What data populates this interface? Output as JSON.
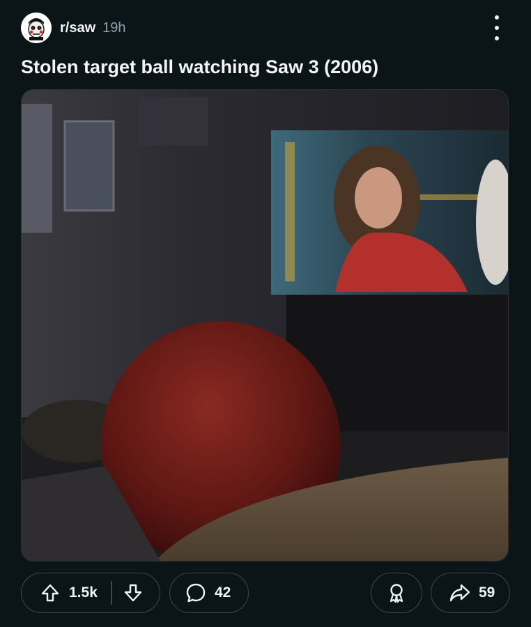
{
  "post": {
    "subreddit": "r/saw",
    "age": "19h",
    "title": "Stolen target ball watching Saw 3 (2006)"
  },
  "actions": {
    "upvotes": "1.5k",
    "comments": "42",
    "shares": "59"
  },
  "icons": {
    "avatar": "jigsaw-puppet-icon",
    "more": "more-vertical-icon",
    "upvote": "arrow-up-icon",
    "downvote": "arrow-down-icon",
    "comment": "comment-bubble-icon",
    "award": "award-ribbon-icon",
    "share": "share-arrow-icon"
  },
  "colors": {
    "background": "#0b1416",
    "text": "#f2f4f5",
    "muted": "#8ba2ad",
    "pill_border": "#3e4a50"
  }
}
